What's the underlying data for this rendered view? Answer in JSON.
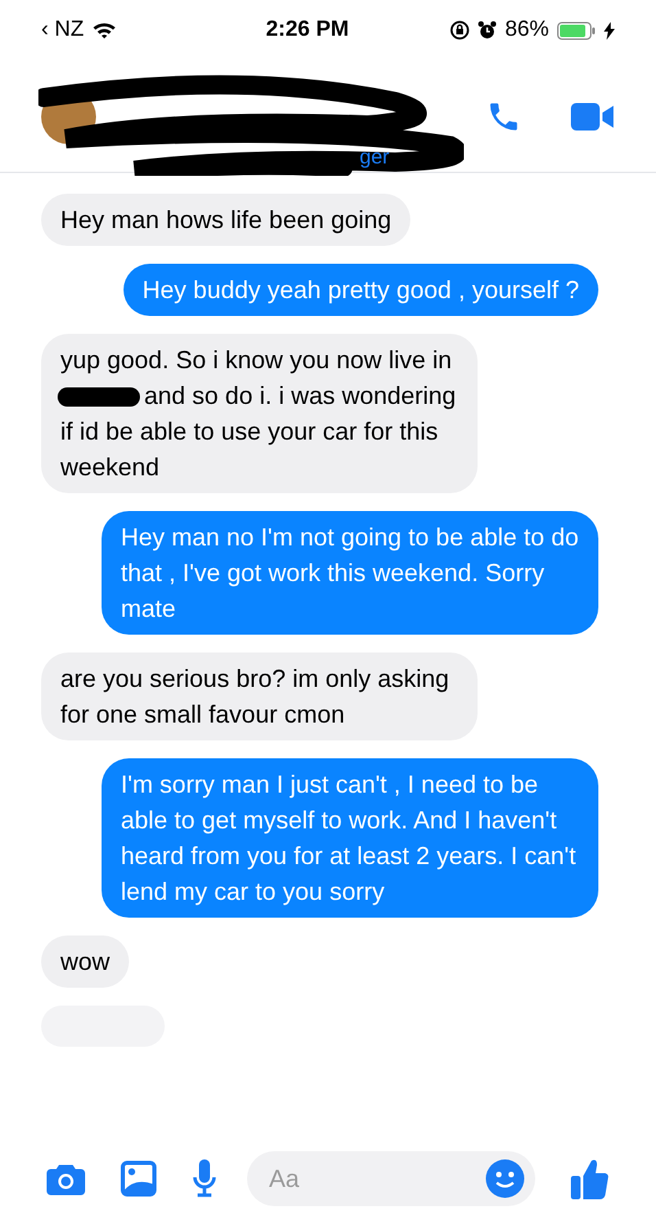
{
  "status_bar": {
    "back_label": "‹ NZ",
    "time": "2:26 PM",
    "battery_percent": "86%",
    "charging": true
  },
  "header": {
    "subtitle_fragment": "ger",
    "name_redacted": true
  },
  "messages": [
    {
      "kind": "received",
      "parts": [
        {
          "text": "Hey man hows life been going"
        }
      ]
    },
    {
      "kind": "sent",
      "parts": [
        {
          "text": "Hey buddy yeah pretty good , yourself ?"
        }
      ]
    },
    {
      "kind": "received",
      "parts": [
        {
          "text": "yup good. So i know you now live in"
        },
        {
          "redacted": true
        },
        {
          "text": "and so do i. i was wondering if id be able to use your car for this weekend"
        }
      ]
    },
    {
      "kind": "sent",
      "parts": [
        {
          "text": "Hey man no I'm not going to be able to do that , I've got work this weekend. Sorry mate"
        }
      ]
    },
    {
      "kind": "received",
      "parts": [
        {
          "text": "are you serious bro? im only asking for one small favour cmon"
        }
      ]
    },
    {
      "kind": "sent",
      "parts": [
        {
          "text": "I'm sorry man I just can't , I need to be able to get myself to work. And I haven't heard from you for at least 2 years. I can't lend my car to you sorry"
        }
      ]
    },
    {
      "kind": "received",
      "parts": [
        {
          "text": "wow"
        }
      ]
    },
    {
      "kind": "cut_off"
    }
  ],
  "composer": {
    "placeholder": "Aa"
  }
}
